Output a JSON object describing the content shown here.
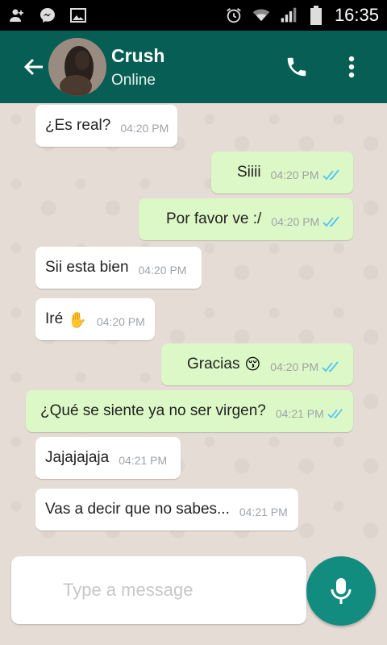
{
  "status_bar": {
    "time": "16:35"
  },
  "header": {
    "contact_name": "Crush",
    "contact_status": "Online"
  },
  "messages": [
    {
      "direction": "in",
      "text": "¿Es real?",
      "time": "04:20 PM"
    },
    {
      "direction": "out",
      "text": "Siiii",
      "time": "04:20 PM",
      "read": true
    },
    {
      "direction": "out",
      "text": "Por favor ve :/",
      "time": "04:20 PM",
      "read": true
    },
    {
      "direction": "in",
      "text": "Sii esta bien",
      "time": "04:20 PM"
    },
    {
      "direction": "in",
      "text": "Iré",
      "emoji": "✋",
      "time": "04:20 PM"
    },
    {
      "direction": "out",
      "text": "Gracias",
      "emoji": "😚",
      "time": "04:20 PM",
      "read": true
    },
    {
      "direction": "out",
      "text": "¿Qué se siente ya no ser virgen?",
      "time": "04:21 PM",
      "read": true
    },
    {
      "direction": "in",
      "text": "Jajajajaja",
      "time": "04:21 PM"
    },
    {
      "direction": "in",
      "text": "Vas a decir que no sabes...",
      "time": "04:21 PM"
    }
  ],
  "composer": {
    "placeholder": "Type a message"
  },
  "colors": {
    "header": "#075e54",
    "incoming": "#ffffff",
    "outgoing": "#dcf8c6",
    "tick": "#4fc3f7",
    "fab": "#128c7e"
  }
}
